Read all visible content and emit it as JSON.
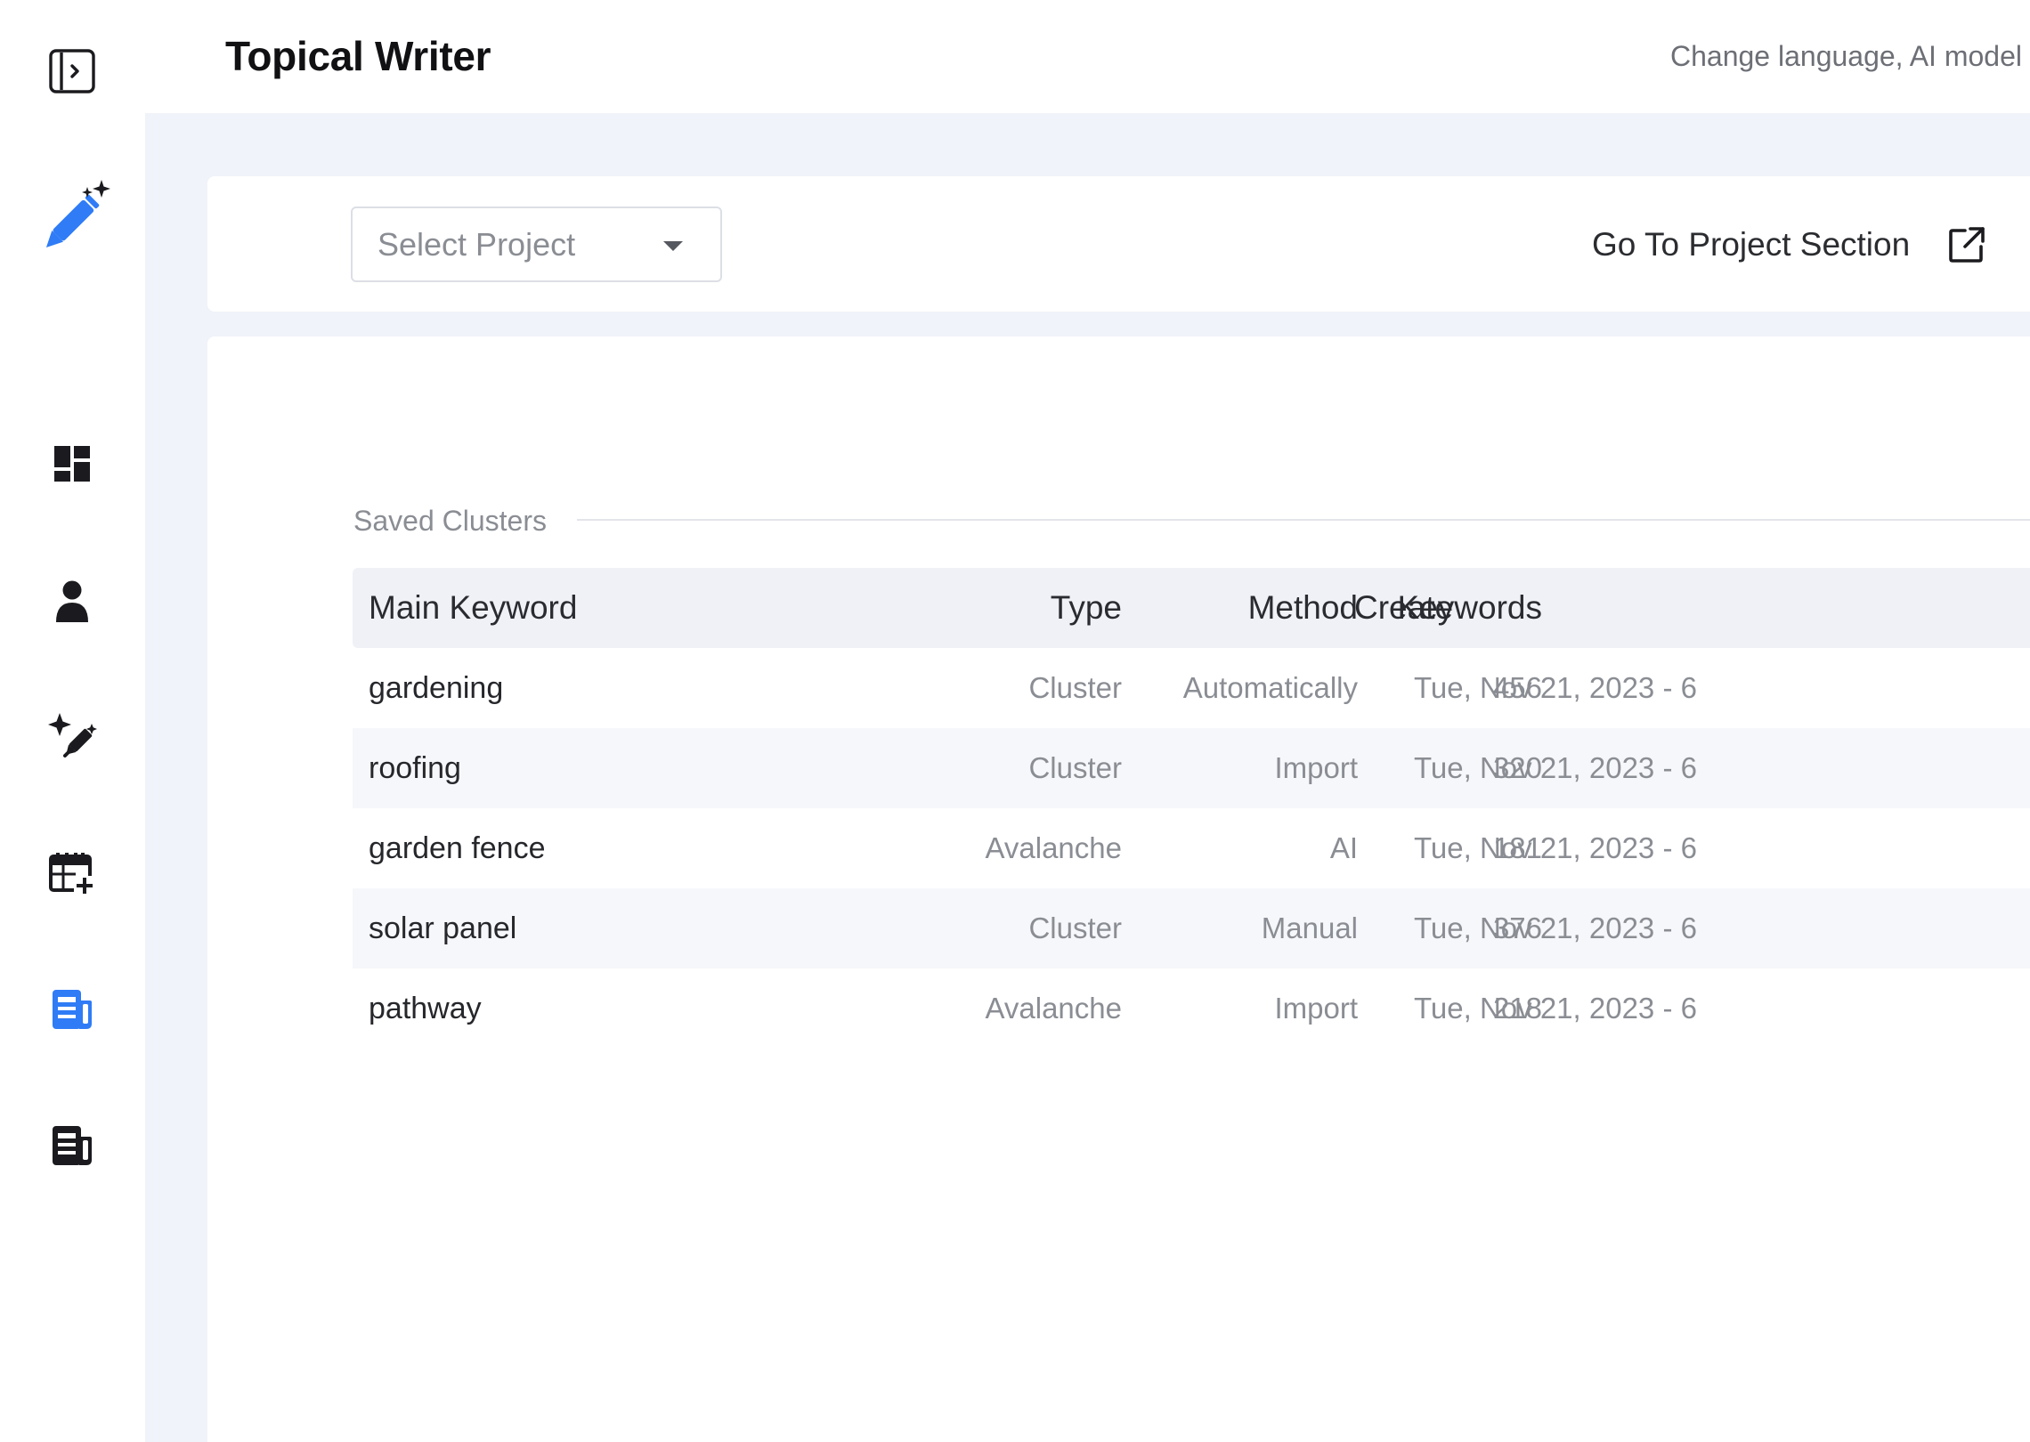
{
  "header": {
    "title": "Topical Writer",
    "hint": "Change language, AI model"
  },
  "sidebar": {
    "items": [
      {
        "name": "toggle-sidebar",
        "icon": "sidebar-toggle-icon"
      },
      {
        "name": "ai-writer",
        "icon": "magic-pen-icon"
      },
      {
        "name": "dashboard",
        "icon": "dashboard-icon"
      },
      {
        "name": "account",
        "icon": "person-icon"
      },
      {
        "name": "ai-edit",
        "icon": "magic-edit-icon"
      },
      {
        "name": "calendar-add",
        "icon": "calendar-add-icon"
      },
      {
        "name": "articles",
        "icon": "article-icon",
        "active": true
      },
      {
        "name": "articles-saved",
        "icon": "article-dark-icon"
      }
    ],
    "accent_color": "#2f7cf6"
  },
  "project": {
    "select_placeholder": "Select Project",
    "goto_label": "Go To Project Section"
  },
  "clusters": {
    "section_label": "Saved Clusters",
    "columns": [
      "Main Keyword",
      "Type",
      "Method",
      "Keywords",
      "Create"
    ],
    "rows": [
      {
        "keyword": "gardening",
        "type": "Cluster",
        "method": "Automatically",
        "count": "456",
        "created": "Tue, Nov 21, 2023 - 6"
      },
      {
        "keyword": "roofing",
        "type": "Cluster",
        "method": "Import",
        "count": "320",
        "created": "Tue, Nov 21, 2023 - 6"
      },
      {
        "keyword": "garden fence",
        "type": "Avalanche",
        "method": "AI",
        "count": "181",
        "created": "Tue, Nov 21, 2023 - 6"
      },
      {
        "keyword": "solar panel",
        "type": "Cluster",
        "method": "Manual",
        "count": "376",
        "created": "Tue, Nov 21, 2023 - 6"
      },
      {
        "keyword": "pathway",
        "type": "Avalanche",
        "method": "Import",
        "count": "218",
        "created": "Tue, Nov 21, 2023 - 6"
      }
    ]
  }
}
